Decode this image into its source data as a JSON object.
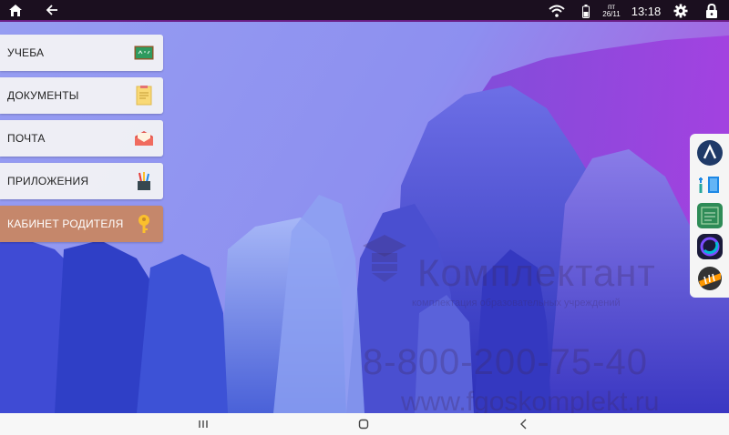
{
  "status_bar": {
    "date_day": "пт",
    "date": "26/11",
    "time": "13:18",
    "icons": [
      "home-icon",
      "back-arrow-icon",
      "wifi-icon",
      "battery-icon",
      "gear-icon",
      "lock-icon"
    ]
  },
  "menu": {
    "items": [
      {
        "label": "УЧЕБА",
        "icon": "chalkboard-icon"
      },
      {
        "label": "ДОКУМЕНТЫ",
        "icon": "document-icon"
      },
      {
        "label": "ПОЧТА",
        "icon": "envelope-icon"
      },
      {
        "label": "ПРИЛОЖЕНИЯ",
        "icon": "pencil-cup-icon"
      },
      {
        "label": "КАБИНЕТ РОДИТЕЛЯ",
        "icon": "key-icon"
      }
    ],
    "active_index": 4
  },
  "dock": {
    "apps": [
      "app-a-icon",
      "app-book-icon",
      "app-green-icon",
      "app-circle-icon",
      "app-mesh-icon"
    ]
  },
  "watermark": {
    "brand": "Комплектант",
    "tagline": "комплектация образовательных учреждений",
    "phone": "8-800-200-75-40",
    "site": "www.fgoskomplekt.ru"
  },
  "nav_bar": {
    "icons": [
      "recents-icon",
      "home-circle-icon",
      "back-chevron-icon"
    ]
  },
  "colors": {
    "status_bar_bg": "#1b0f1f",
    "wallpaper_sky": "#8f96f0",
    "active_menu": "#c5876b"
  }
}
